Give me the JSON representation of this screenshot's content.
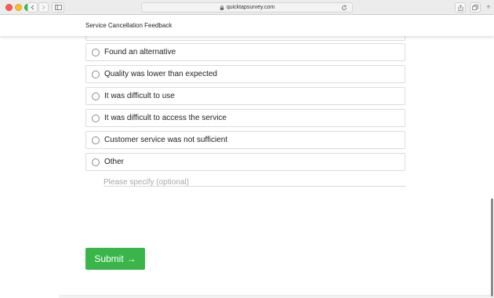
{
  "browser": {
    "url": "quicktapsurvey.com",
    "icons": [
      "back-arrow",
      "forward-arrow",
      "sidebar",
      "lock",
      "reload",
      "share",
      "tabs",
      "plus"
    ]
  },
  "header": {
    "title": "Service Cancellation Feedback"
  },
  "options": [
    {
      "label": "Found an alternative"
    },
    {
      "label": "Quality was lower than expected"
    },
    {
      "label": "It was difficult to use"
    },
    {
      "label": "It was difficult to access the service"
    },
    {
      "label": "Customer service was not sufficient"
    },
    {
      "label": "Other"
    }
  ],
  "specify": {
    "placeholder": "Please specify (optional)",
    "value": ""
  },
  "submit": {
    "label": "Submit",
    "arrow": "→",
    "color": "#3ab54a"
  }
}
